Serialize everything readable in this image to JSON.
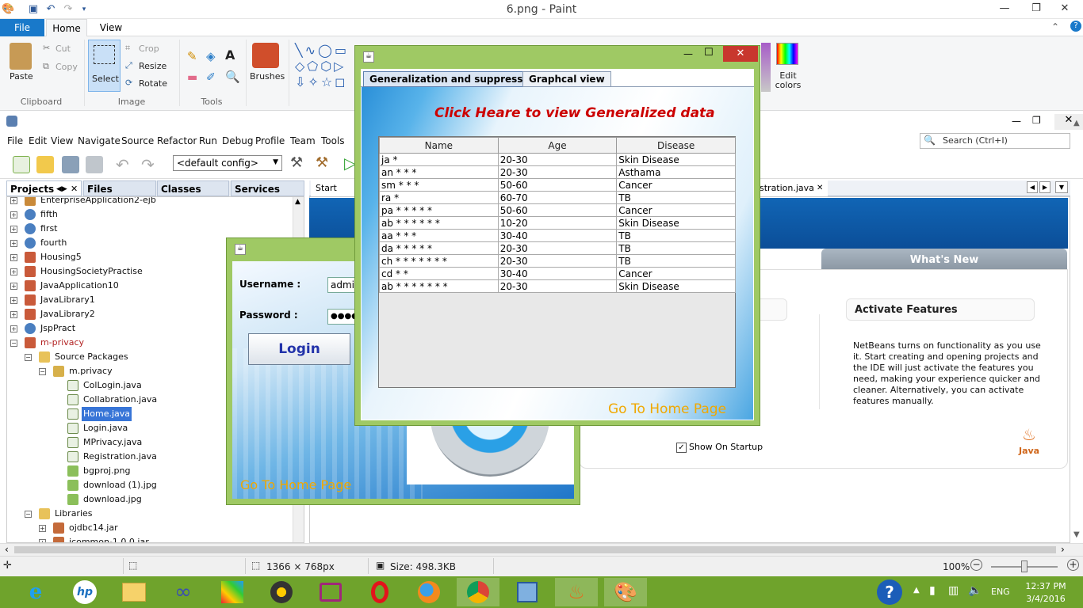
{
  "paint": {
    "title": "6.png - Paint",
    "tabs": [
      "File",
      "Home",
      "View"
    ],
    "clipboard": {
      "paste": "Paste",
      "cut": "Cut",
      "copy": "Copy",
      "label": "Clipboard"
    },
    "image": {
      "select": "Select",
      "crop": "Crop",
      "resize": "Resize",
      "rotate": "Rotate",
      "label": "Image"
    },
    "tools_label": "Tools",
    "brushes": "Brushes",
    "edit_colors": "Edit colors"
  },
  "netbeans": {
    "menu": [
      "File",
      "Edit",
      "View",
      "Navigate",
      "Source",
      "Refactor",
      "Run",
      "Debug",
      "Profile",
      "Team",
      "Tools"
    ],
    "config": "<default config>",
    "search_placeholder": "Search (Ctrl+I)",
    "panel_tabs": [
      "Projects",
      "Files",
      "Classes",
      "Services"
    ],
    "tree": [
      {
        "label": "EnterpriseApplication2-ejb",
        "level": 0,
        "expander": "+",
        "icon": "bean"
      },
      {
        "label": "fifth",
        "level": 0,
        "expander": "+",
        "icon": "globe"
      },
      {
        "label": "first",
        "level": 0,
        "expander": "+",
        "icon": "globe"
      },
      {
        "label": "fourth",
        "level": 0,
        "expander": "+",
        "icon": "globe"
      },
      {
        "label": "Housing5",
        "level": 0,
        "expander": "+",
        "icon": "cup"
      },
      {
        "label": "HousingSocietyPractise",
        "level": 0,
        "expander": "+",
        "icon": "cup"
      },
      {
        "label": "JavaApplication10",
        "level": 0,
        "expander": "+",
        "icon": "cup"
      },
      {
        "label": "JavaLibrary1",
        "level": 0,
        "expander": "+",
        "icon": "cup"
      },
      {
        "label": "JavaLibrary2",
        "level": 0,
        "expander": "+",
        "icon": "cup"
      },
      {
        "label": "JspPract",
        "level": 0,
        "expander": "+",
        "icon": "globe"
      },
      {
        "label": "m-privacy",
        "level": 0,
        "expander": "−",
        "icon": "cup",
        "color": "#b22222"
      },
      {
        "label": "Source Packages",
        "level": 1,
        "expander": "−",
        "icon": "folder"
      },
      {
        "label": "m.privacy",
        "level": 2,
        "expander": "−",
        "icon": "package"
      },
      {
        "label": "ColLogin.java",
        "level": 3,
        "icon": "java"
      },
      {
        "label": "Collabration.java",
        "level": 3,
        "icon": "java"
      },
      {
        "label": "Home.java",
        "level": 3,
        "icon": "java",
        "selected": true
      },
      {
        "label": "Login.java",
        "level": 3,
        "icon": "java"
      },
      {
        "label": "MPrivacy.java",
        "level": 3,
        "icon": "java"
      },
      {
        "label": "Registration.java",
        "level": 3,
        "icon": "java"
      },
      {
        "label": "bgproj.png",
        "level": 3,
        "icon": "image"
      },
      {
        "label": "download (1).jpg",
        "level": 3,
        "icon": "image"
      },
      {
        "label": "download.jpg",
        "level": 3,
        "icon": "image"
      },
      {
        "label": "Libraries",
        "level": 1,
        "expander": "−",
        "icon": "folder"
      },
      {
        "label": "ojdbc14.jar",
        "level": 2,
        "expander": "+",
        "icon": "jar"
      },
      {
        "label": "jcommon-1.0.0.jar",
        "level": 2,
        "expander": "+",
        "icon": "jar"
      }
    ],
    "editor_tabs": [
      "Start Page",
      "stration.java"
    ],
    "start_page": {
      "whats_new": "What's New",
      "activate_title": "Activate Features",
      "activate_text": "NetBeans turns on functionality as you use it. Start creating and opening projects and the IDE will just activate the features you need, making your experience quicker and cleaner. Alternatively, you can activate features manually.",
      "show_on_startup": "Show On Startup",
      "java_logo": "Java"
    }
  },
  "login": {
    "username_label": "Username :",
    "username_value": "admin",
    "password_label": "Password :",
    "password_value": "●●●●●",
    "login_button": "Login",
    "home_link": "Go To Home Page"
  },
  "dialog": {
    "tabs": [
      "Generalization and suppression",
      "Graphcal view"
    ],
    "headline": "Click Heare to view Generalized data",
    "columns": [
      "Name",
      "Age",
      "Disease"
    ],
    "rows": [
      [
        "ja *",
        "20-30",
        "Skin Disease"
      ],
      [
        "an * * *",
        "20-30",
        "Asthama"
      ],
      [
        "sm * * *",
        "50-60",
        "Cancer"
      ],
      [
        "ra *",
        "60-70",
        "TB"
      ],
      [
        "pa * * * * *",
        "50-60",
        "Cancer"
      ],
      [
        "ab * * * * * *",
        "10-20",
        "Skin Disease"
      ],
      [
        "aa * * *",
        "30-40",
        "TB"
      ],
      [
        "da * * * * *",
        "20-30",
        "TB"
      ],
      [
        "ch * * * * * * *",
        "20-30",
        "TB"
      ],
      [
        "cd * *",
        "30-40",
        "Cancer"
      ],
      [
        "ab * * * * * * *",
        "20-30",
        "Skin Disease"
      ]
    ],
    "home_link": "Go To Home Page"
  },
  "status": {
    "dimensions": "1366 × 768px",
    "size": "Size: 498.3KB",
    "zoom": "100%"
  },
  "taskbar": {
    "apps": [
      "internet-explorer",
      "hp",
      "file-explorer",
      "infinity",
      "puzzle",
      "media-player",
      "remote-desktop",
      "opera",
      "firefox",
      "chrome",
      "virtualbox",
      "java",
      "paint"
    ],
    "help": "?",
    "lang": "ENG",
    "time": "12:37 PM",
    "date": "3/4/2016"
  },
  "colors": {
    "taskbar": "#6fa32c",
    "window_frame": "#9fc964",
    "headline": "#cc0000",
    "home_link": "#f0a800",
    "paint_file_tab": "#1979ca"
  }
}
